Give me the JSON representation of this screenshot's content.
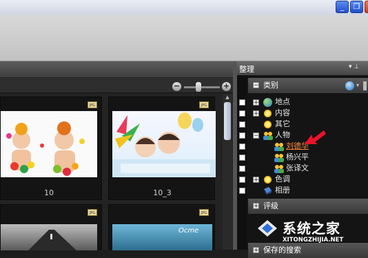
{
  "window_controls": [
    "_",
    "❐",
    "✕"
  ],
  "viewer": {
    "zoom_minus": "−",
    "zoom_plus": "+",
    "items": [
      {
        "caption": "10",
        "badge": "JPG"
      },
      {
        "caption": "10_3",
        "badge": "JPG"
      },
      {
        "caption": "",
        "badge": "JPG"
      },
      {
        "caption": "",
        "badge": "JPG"
      }
    ],
    "photo_text": "Ocme"
  },
  "panel": {
    "title": "整理",
    "pin": "▾  ⊥",
    "category_section": {
      "expander": "−",
      "label": "类别",
      "items": [
        {
          "label": "地点",
          "expander": "+",
          "icon": "globe-icon"
        },
        {
          "label": "内容",
          "expander": "+",
          "icon": "sun-icon"
        },
        {
          "label": "其它",
          "expander": "",
          "icon": "sun-icon"
        },
        {
          "label": "人物",
          "expander": "−",
          "icon": "people-icon"
        },
        {
          "label": "刘德华",
          "expander": "",
          "icon": "person-icon",
          "highlight": true
        },
        {
          "label": "杨兴平",
          "expander": "",
          "icon": "person-icon"
        },
        {
          "label": "张译文",
          "expander": "",
          "icon": "person-icon"
        },
        {
          "label": "色调",
          "expander": "+",
          "icon": "sun-icon"
        },
        {
          "label": "相册",
          "expander": "",
          "icon": "album-icon"
        }
      ]
    },
    "rating_section": {
      "expander": "+",
      "label": "评级"
    },
    "saved_section": {
      "expander": "+",
      "label": "保存的搜索"
    }
  },
  "watermark": {
    "title": "系统之家",
    "url": "XITONGZHIJIA.NET"
  },
  "colors": {
    "highlight_text": "#ff8a3d",
    "arrow": "#e8132a"
  }
}
